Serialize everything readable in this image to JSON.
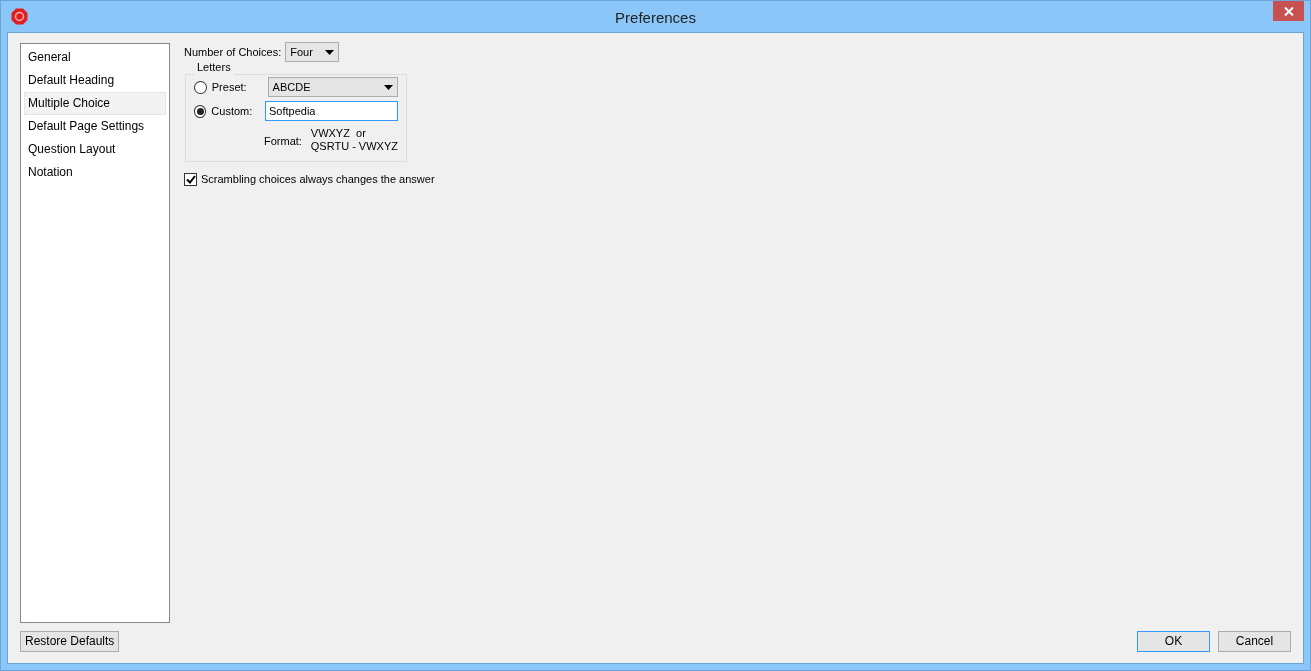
{
  "window": {
    "title": "Preferences"
  },
  "sidebar": {
    "items": [
      {
        "label": "General",
        "selected": false
      },
      {
        "label": "Default Heading",
        "selected": false
      },
      {
        "label": "Multiple Choice",
        "selected": true
      },
      {
        "label": "Default Page Settings",
        "selected": false
      },
      {
        "label": "Question Layout",
        "selected": false
      },
      {
        "label": "Notation",
        "selected": false
      }
    ]
  },
  "number_of_choices": {
    "label": "Number of Choices:",
    "value": "Four"
  },
  "letters": {
    "legend": "Letters",
    "options": [
      {
        "kind": "dropdown",
        "label": "Preset:",
        "selected": false,
        "value": "ABCDE"
      },
      {
        "kind": "text",
        "label": "Custom:",
        "selected": true,
        "value": "Softpedia"
      }
    ],
    "format": {
      "label": "Format:",
      "lines": [
        "VWXYZ  or",
        "QSRTU - VWXYZ"
      ]
    }
  },
  "scramble": {
    "label": "Scrambling choices always changes the answer",
    "checked": true
  },
  "buttons": {
    "restore": "Restore Defaults",
    "ok": "OK",
    "cancel": "Cancel"
  }
}
